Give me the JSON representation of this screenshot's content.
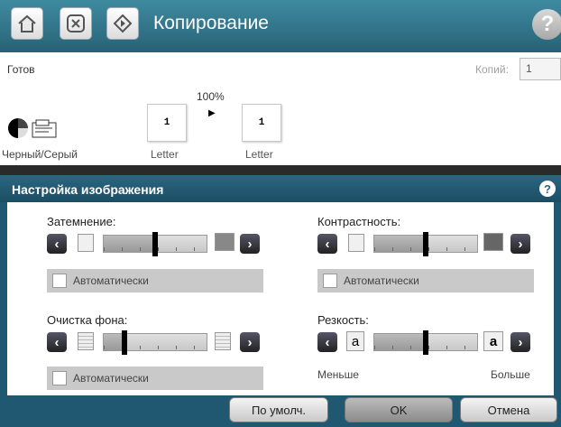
{
  "header": {
    "title": "Копирование",
    "home_icon": "home-icon",
    "stop_icon": "stop-icon",
    "start_icon": "start-icon",
    "help_icon": "help-icon"
  },
  "status": {
    "state": "Готов",
    "copies_label": "Копий:",
    "copies_value": "1",
    "zoom": "100%",
    "source_paper": "Letter",
    "output_paper": "Letter",
    "paper_sides_source": "1",
    "paper_sides_output": "1",
    "color_mode": "Черный/Серый"
  },
  "dialog": {
    "title": "Настройка изображения",
    "help_glyph": "?",
    "darkness": {
      "label": "Затемнение:",
      "auto_label": "Автоматически",
      "level": 0.5
    },
    "contrast": {
      "label": "Контрастность:",
      "auto_label": "Автоматически",
      "level": 0.5
    },
    "background_cleanup": {
      "label": "Очистка фона:",
      "auto_label": "Автоматически",
      "level": 0.2
    },
    "sharpness": {
      "label": "Резкость:",
      "min_label": "Меньше",
      "max_label": "Больше",
      "left_glyph": "a",
      "right_glyph": "a",
      "level": 0.5
    },
    "buttons": {
      "default_label": "По умолч.",
      "ok_label": "OK",
      "cancel_label": "Отмена"
    }
  },
  "colors": {
    "header_bg": "#2f6f84",
    "dialog_bar": "#1b4e65",
    "slider_fill": "#aaaaaa"
  }
}
